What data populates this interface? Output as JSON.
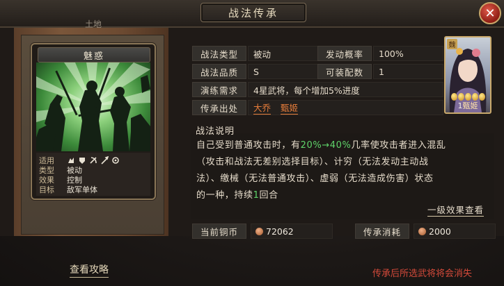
{
  "window": {
    "title": "战法传承",
    "close_symbol": "✕",
    "terrain_label": "土地"
  },
  "skill_card": {
    "name": "魅惑",
    "stats": [
      {
        "label": "适用",
        "value": ""
      },
      {
        "label": "类型",
        "value": "被动"
      },
      {
        "label": "效果",
        "value": "控制"
      },
      {
        "label": "目标",
        "value": "敌军单体"
      }
    ],
    "applicable_icons": [
      "cavalry-icon",
      "shield-icon",
      "bow-icon",
      "spear-icon",
      "siege-icon"
    ]
  },
  "info": {
    "type_label": "战法类型",
    "type_value": "被动",
    "rate_label": "发动概率",
    "rate_value": "100%",
    "quality_label": "战法品质",
    "quality_value": "S",
    "equip_label": "可装配数",
    "equip_value": "1",
    "practice_label": "演练需求",
    "practice_value": "4星武将，每个增加5%进度",
    "source_label": "传承出处",
    "source_1": "大乔",
    "source_2": "甄姬"
  },
  "hero": {
    "faction": "魏",
    "level": "1",
    "name": "甄姬",
    "stars": 5
  },
  "description": {
    "title": "战法说明",
    "line1_a": "自己受到普通攻击时，有",
    "line1_highlight": "20%→40%",
    "line1_b": "几率使攻击者进入混乱",
    "line2": "（攻击和战法无差别选择目标）、计穷（无法发动主动战",
    "line3": "法）、缴械（无法普通攻击）、虚弱（无法造成伤害）状态",
    "line4_a": "的一种，持续",
    "line4_num": "1",
    "line4_b": "回合",
    "details_link": "一级效果查看"
  },
  "costs": {
    "copper_label": "当前铜币",
    "copper_value": "72062",
    "inherit_label": "传承消耗",
    "inherit_value": "2000"
  },
  "footer": {
    "guide_link": "查看攻略",
    "warning": "传承后所选武将将会消失"
  },
  "colors": {
    "accent_orange": "#e57c3a",
    "highlight_green": "#5fd36a",
    "warning_red": "#d44a3a"
  }
}
